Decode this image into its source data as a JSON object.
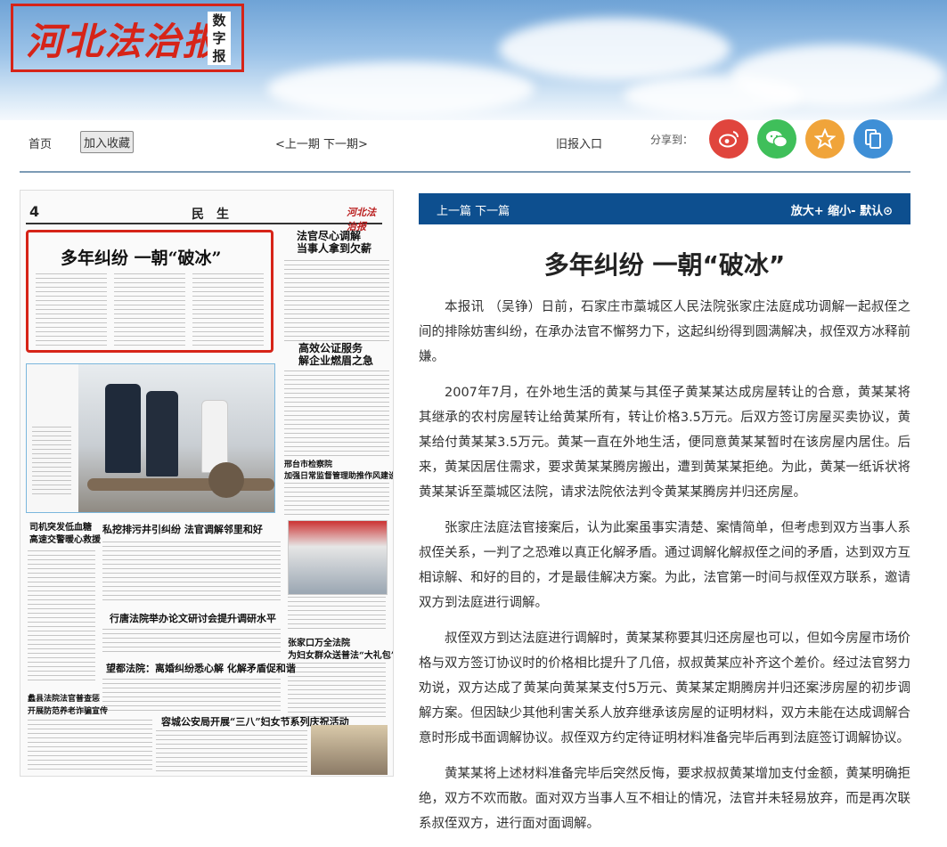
{
  "logo": {
    "text": "河北法治报",
    "sub": "数字报"
  },
  "nav": {
    "home": "首页",
    "bookmark": "加入收藏",
    "prev_next": "<上一期  下一期>",
    "archive": "旧报入口",
    "share_label": "分享到：",
    "share_icons": [
      {
        "name": "weibo-icon",
        "color": "#e0453d",
        "glyph": "◉"
      },
      {
        "name": "wechat-icon",
        "color": "#3fbf5a",
        "glyph": "✉"
      },
      {
        "name": "star-icon",
        "color": "#f0a43a",
        "glyph": "★"
      },
      {
        "name": "mobile-icon",
        "color": "#3f8fd6",
        "glyph": "❐"
      }
    ]
  },
  "newspaper": {
    "page_number": "4",
    "section": "民　生",
    "brand": "河北法治报",
    "lead_title": "多年纠纷  一朝“破冰”",
    "side_head_1": "法官尽心调解\n当事人拿到欠薪",
    "side_head_2": "高效公证服务\n解企业燃眉之急",
    "side_head_3": "邢台市检察院\n加强日常监督管理助推作风建设",
    "left_head_1": "司机突发低血糖\n高速交警暖心救援",
    "mid_head_1": "私挖排污井引纠纷  法官调解邻里和好",
    "mid_head_2": "行唐法院举办论文研讨会提升调研水平",
    "mid_head_3": "望都法院：离婚纠纷悉心解  化解矛盾促和谐",
    "right_head_4": "张家口万全法院\n为妇女群众送普法“大礼包”",
    "left_head_2": "蠡县法院法官普查惩\n开展防范养老诈骗宣传",
    "bottom_head": "容城公安局开展“三八”妇女节系列庆祝活动"
  },
  "article_bar": {
    "prev_next": "上一篇  下一篇",
    "zoom": "放大+   缩小-   默认⊙"
  },
  "article": {
    "title": "多年纠纷 一朝“破冰”",
    "paragraphs": [
      "本报讯 （吴铮）日前，石家庄市藁城区人民法院张家庄法庭成功调解一起叔侄之间的排除妨害纠纷，在承办法官不懈努力下，这起纠纷得到圆满解决，叔侄双方冰释前嫌。",
      "2007年7月，在外地生活的黄某与其侄子黄某某达成房屋转让的合意，黄某某将其继承的农村房屋转让给黄某所有，转让价格3.5万元。后双方签订房屋买卖协议，黄某给付黄某某3.5万元。黄某一直在外地生活，便同意黄某某暂时在该房屋内居住。后来，黄某因居住需求，要求黄某某腾房搬出，遭到黄某某拒绝。为此，黄某一纸诉状将黄某某诉至藁城区法院，请求法院依法判令黄某某腾房并归还房屋。",
      "张家庄法庭法官接案后，认为此案虽事实清楚、案情简单，但考虑到双方当事人系叔侄关系，一判了之恐难以真正化解矛盾。通过调解化解叔侄之间的矛盾，达到双方互相谅解、和好的目的，才是最佳解决方案。为此，法官第一时间与叔侄双方联系，邀请双方到法庭进行调解。",
      "叔侄双方到达法庭进行调解时，黄某某称要其归还房屋也可以，但如今房屋市场价格与双方签订协议时的价格相比提升了几倍，叔叔黄某应补齐这个差价。经过法官努力劝说，双方达成了黄某向黄某某支付5万元、黄某某定期腾房并归还案涉房屋的初步调解方案。但因缺少其他利害关系人放弃继承该房屋的证明材料，双方未能在达成调解合意时形成书面调解协议。叔侄双方约定待证明材料准备完毕后再到法庭签订调解协议。",
      "黄某某将上述材料准备完毕后突然反悔，要求叔叔黄某增加支付金额，黄某明确拒绝，双方不欢而散。面对双方当事人互不相让的情况，法官并未轻易放弃，而是再次联系叔侄双方，进行面对面调解。"
    ]
  }
}
